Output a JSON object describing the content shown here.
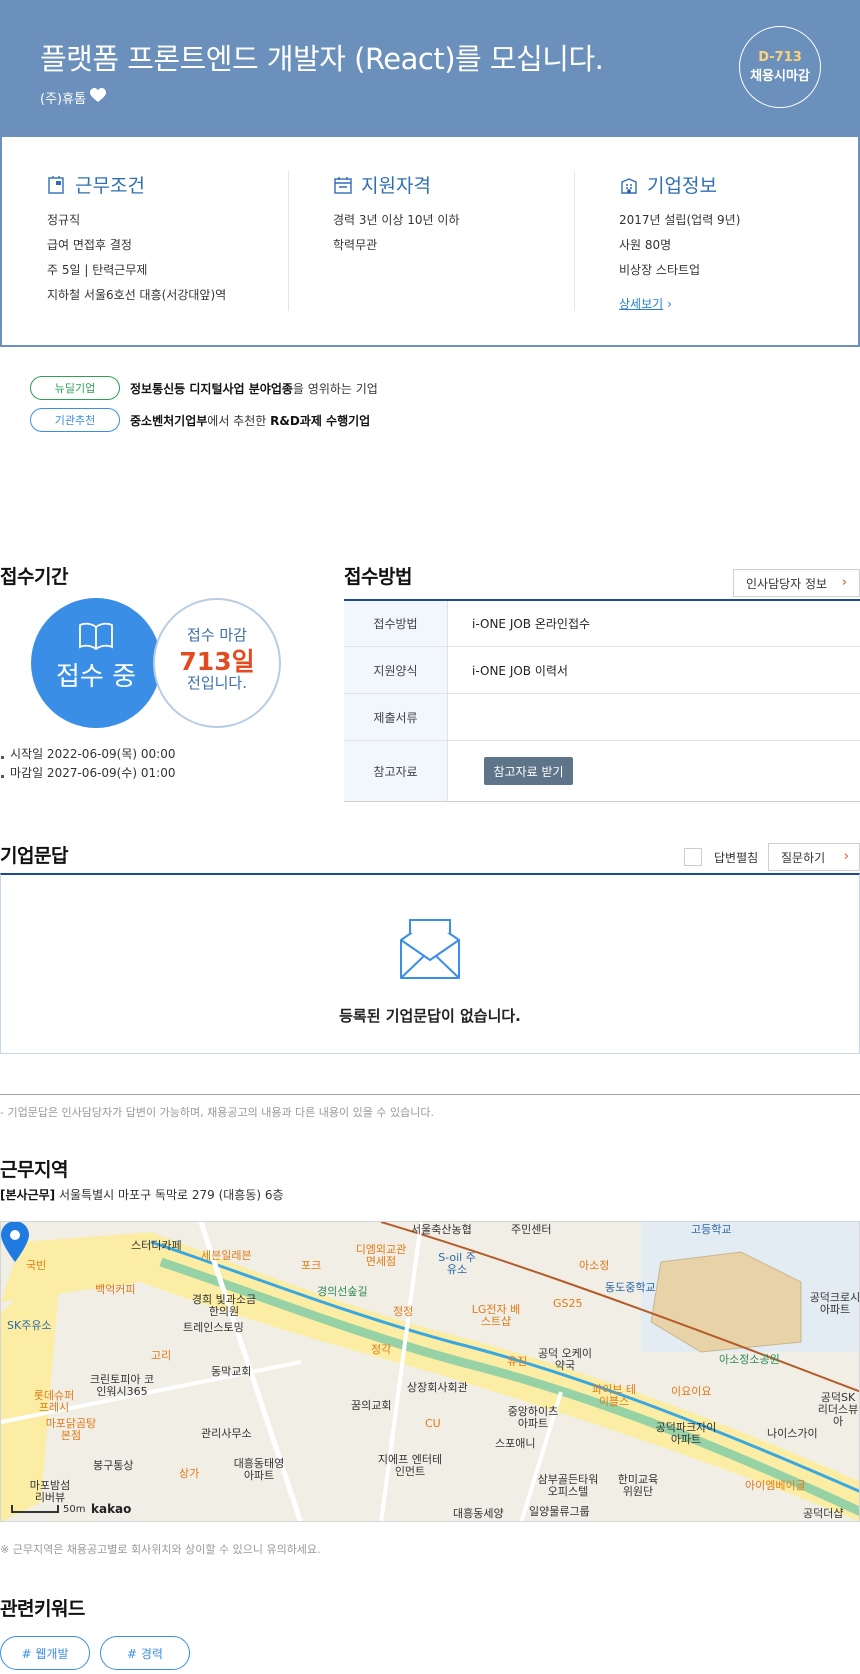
{
  "header": {
    "title": "플랫폼 프론트엔드 개발자 (React)를 모십니다.",
    "company": "(주)휴톰",
    "dday": "D-713",
    "dday_label": "채용시마감"
  },
  "summary": {
    "work": {
      "title": "근무조건",
      "items": [
        "정규직",
        "급여 면접후 결정",
        "주 5일 | 탄력근무제",
        "지하철 서울6호선 대흥(서강대앞)역"
      ]
    },
    "qualification": {
      "title": "지원자격",
      "items": [
        "경력 3년 이상 10년 이하",
        "학력무관"
      ]
    },
    "company_info": {
      "title": "기업정보",
      "items": [
        "2017년 설립(업력 9년)",
        "사원 80명",
        "비상장 스타트업"
      ],
      "detail_link": "상세보기"
    }
  },
  "tags": [
    {
      "pill": "뉴딜기업",
      "bold1": "정보통신등 디지털사업 분야업종",
      "text1": "을 영위하는 기업",
      "bold2": "",
      "text2": ""
    },
    {
      "pill": "기관추천",
      "bold1": "중소벤처기업부",
      "text1": "에서 추천한 ",
      "bold2": "R&D과제 수행기업",
      "text2": ""
    }
  ],
  "period": {
    "title": "접수기간",
    "status": "접수 중",
    "deadline_label": "접수 마감",
    "days_left": "713일",
    "deadline_suffix": "전입니다.",
    "start": "시작일 2022-06-09(목) 00:00",
    "end": "마감일 2027-06-09(수) 01:00"
  },
  "method": {
    "title": "접수방법",
    "hr_button": "인사담당자 정보",
    "rows": [
      {
        "key": "접수방법",
        "value": "i-ONE JOB 온라인접수"
      },
      {
        "key": "지원양식",
        "value": "i-ONE JOB 이력서"
      },
      {
        "key": "제출서류",
        "value": ""
      },
      {
        "key": "참고자료",
        "value": ""
      }
    ],
    "ref_button": "참고자료 받기"
  },
  "qna": {
    "title": "기업문답",
    "toggle_label": "답변펼침",
    "ask_button": "질문하기",
    "empty_text": "등록된 기업문답이 없습니다.",
    "note": "- 기업문답은 인사담당자가 답변이 가능하며, 채용공고의 내용과 다른 내용이 있을 수 있습니다."
  },
  "location": {
    "title": "근무지역",
    "address_prefix": "[본사근무]",
    "address": "서울특별시 마포구 독막로 279 (대흥동) 6층",
    "map_scale": "50m",
    "map_logo": "kakao",
    "note": "※ 근무지역은 채용공고별로 회사위치와 상이할 수 있으니 유의하세요.",
    "map_labels": [
      "스터디카페",
      "세븐일레븐",
      "포크",
      "디엠외교관 면세점",
      "서울축산농협",
      "주민센터",
      "고등학교",
      "국빈",
      "S-oil 주유소",
      "아소정",
      "동도중학교",
      "백억커피",
      "경희 빛과소금 한의원",
      "경의선숲길",
      "정정",
      "LG전자 베스트샵",
      "GS25",
      "공덕크로시 아파트",
      "SK주유소",
      "트레인스토밍",
      "정각",
      "고리",
      "유진",
      "공덕 오케이약국",
      "아소정소공원",
      "크린토피아 코인워시365",
      "동막교회",
      "롯데슈퍼 프레시",
      "꿈의교회",
      "상장회사회관",
      "파이브 테이블스",
      "이요이요",
      "공덕SK 리더스뷰아",
      "마포닭곰탕 본점",
      "관리사무소",
      "CU",
      "중앙하이츠 아파트",
      "공덕파크자이 아파트",
      "나이스가이",
      "봉구통상",
      "상가",
      "대흥동태영 아파트",
      "스포애니",
      "지에프 엔터테인먼트",
      "삼부골든타워 오피스텔",
      "한미교육 위원단",
      "아이엠베이글",
      "마포밤섬 리버뷰",
      "대흥동세양",
      "일양물류그룹",
      "공덕더샵"
    ]
  },
  "keywords": {
    "title": "관련키워드",
    "items": [
      "# 웹개발",
      "# 경력"
    ]
  },
  "colors": {
    "header_bg": "#6b90bc",
    "accent_blue": "#3a8ee6",
    "accent_orange": "#e24b1f",
    "navy": "#1d4c8c"
  }
}
